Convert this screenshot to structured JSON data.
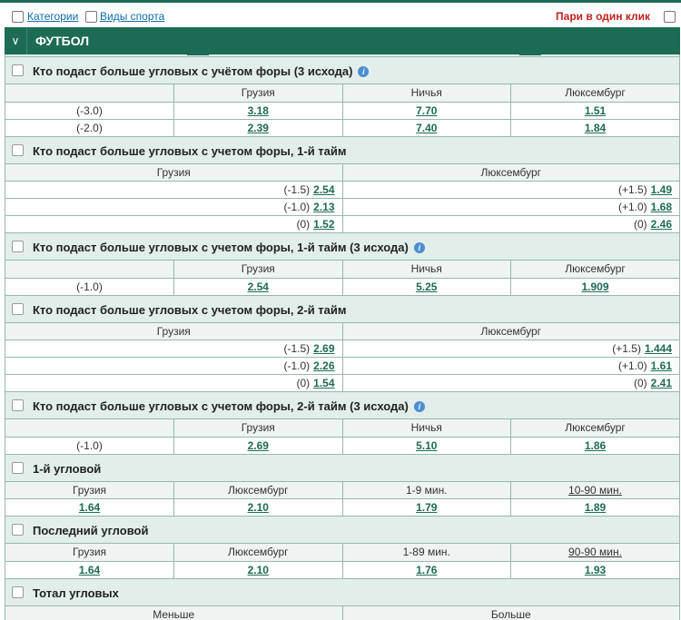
{
  "topbar": {
    "categories": "Категории",
    "sports": "Виды спорта",
    "one_click": "Пари в один клик"
  },
  "sport": {
    "chevron": "∨",
    "title": "ФУТБОЛ"
  },
  "markets": {
    "m1": {
      "title": "Кто подаст больше угловых с учётом форы (3 исхода)",
      "h": [
        "",
        "Грузия",
        "Ничья",
        "Люксембург"
      ],
      "rows": [
        [
          "(-3.0)",
          "3.18",
          "7.70",
          "1.51"
        ],
        [
          "(-2.0)",
          "2.39",
          "7.40",
          "1.84"
        ]
      ]
    },
    "m2": {
      "title": "Кто подаст больше угловых с учетом форы, 1-й тайм",
      "h": [
        "Грузия",
        "Люксембург"
      ],
      "rows": [
        [
          "(-1.5)",
          "2.54",
          "(+1.5)",
          "1.49"
        ],
        [
          "(-1.0)",
          "2.13",
          "(+1.0)",
          "1.68"
        ],
        [
          "(0)",
          "1.52",
          "(0)",
          "2.46"
        ]
      ]
    },
    "m3": {
      "title": "Кто подаст больше угловых с учетом форы, 1-й тайм (3 исхода)",
      "h": [
        "",
        "Грузия",
        "Ничья",
        "Люксембург"
      ],
      "rows": [
        [
          "(-1.0)",
          "2.54",
          "5.25",
          "1.909"
        ]
      ]
    },
    "m4": {
      "title": "Кто подаст больше угловых с учетом форы, 2-й тайм",
      "h": [
        "Грузия",
        "Люксембург"
      ],
      "rows": [
        [
          "(-1.5)",
          "2.69",
          "(+1.5)",
          "1.444"
        ],
        [
          "(-1.0)",
          "2.26",
          "(+1.0)",
          "1.61"
        ],
        [
          "(0)",
          "1.54",
          "(0)",
          "2.41"
        ]
      ]
    },
    "m5": {
      "title": "Кто подаст больше угловых с учетом форы, 2-й тайм (3 исхода)",
      "h": [
        "",
        "Грузия",
        "Ничья",
        "Люксембург"
      ],
      "rows": [
        [
          "(-1.0)",
          "2.69",
          "5.10",
          "1.86"
        ]
      ]
    },
    "m6": {
      "title": "1-й угловой",
      "h": [
        "Грузия",
        "Люксембург",
        "1-9 мин.",
        "10-90 мин."
      ],
      "rows": [
        [
          "1.64",
          "2.10",
          "1.79",
          "1.89"
        ]
      ]
    },
    "m7": {
      "title": "Последний угловой",
      "h": [
        "Грузия",
        "Люксембург",
        "1-89 мин.",
        "90-90 мин."
      ],
      "rows": [
        [
          "1.64",
          "2.10",
          "1.76",
          "1.93"
        ]
      ]
    },
    "m8": {
      "title": "Тотал угловых",
      "h": [
        "Меньше",
        "Больше"
      ]
    }
  },
  "info_icon": "i",
  "colors": {
    "accent": "#1d6b55",
    "header_bg": "#e2eeea",
    "link": "#0e6aa8",
    "alert": "#c0231e"
  }
}
